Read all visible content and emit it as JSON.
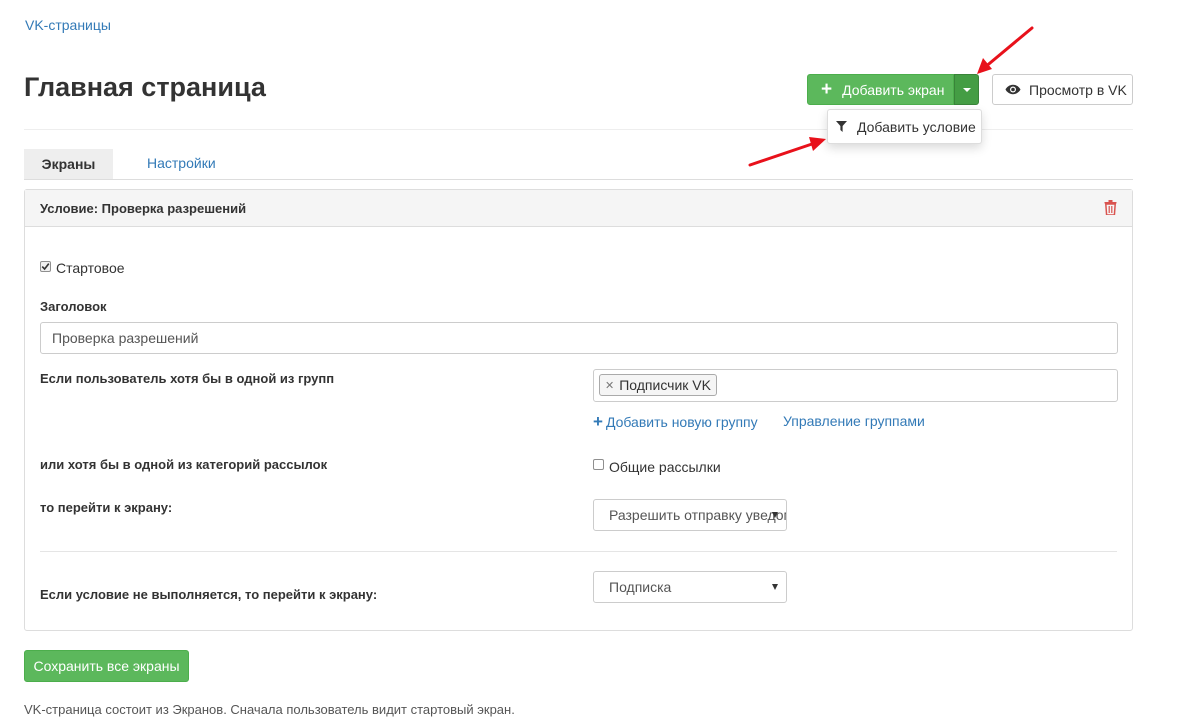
{
  "breadcrumb": "VK-страницы",
  "page_title": "Главная страница",
  "header": {
    "add_screen_label": "Добавить экран",
    "view_in_vk_label": "Просмотр в VK",
    "dropdown_item_label": "Добавить условие"
  },
  "tabs": [
    {
      "label": "Экраны",
      "active": true
    },
    {
      "label": "Настройки",
      "active": false
    }
  ],
  "panel": {
    "title": "Условие: Проверка разрешений",
    "start_checkbox": {
      "label": "Стартовое",
      "checked": true
    },
    "title_field": {
      "label": "Заголовок",
      "value": "Проверка разрешений"
    },
    "groups": {
      "label": "Если пользователь хотя бы в одной из групп",
      "selected_tag": "Подписчик VK",
      "add_group_link": "Добавить новую группу",
      "manage_groups_link": "Управление группами"
    },
    "categories": {
      "label": "или хотя бы в одной из категорий рассылок",
      "option_label": "Общие рассылки",
      "checked": false
    },
    "goto": {
      "label": "то перейти к экрану:",
      "selected": "Разрешить отправку уведомлений"
    },
    "else_goto": {
      "label": "Если условие не выполняется, то перейти к экрану:",
      "selected": "Подписка"
    }
  },
  "save_button_label": "Сохранить все экраны",
  "footer_note": "VK-страница состоит из Экранов. Сначала пользователь видит стартовый экран.",
  "colors": {
    "accent_green": "#5cb85c",
    "link_blue": "#337ab7",
    "annotation_red": "#e8111b",
    "delete_red": "#d9534f"
  },
  "icons": [
    "plus-icon",
    "caret-down-icon",
    "eye-icon",
    "filter-icon",
    "trash-icon",
    "remove-tag-icon",
    "select-arrow-icon"
  ]
}
